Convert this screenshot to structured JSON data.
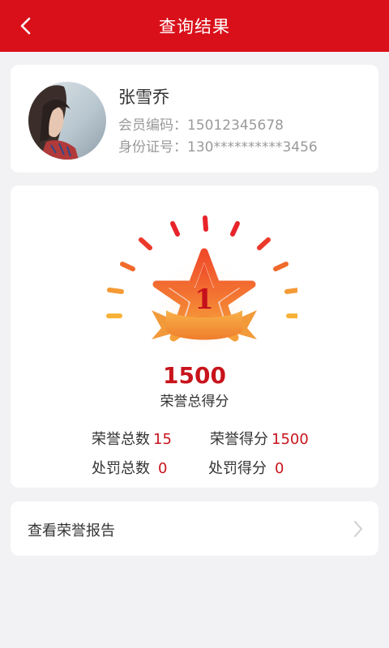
{
  "header": {
    "title": "查询结果"
  },
  "profile": {
    "name": "张雪乔",
    "member_line": "会员编码：15012345678",
    "id_line": "身份证号：130**********3456"
  },
  "honor": {
    "badge_rank": "1",
    "total_score": "1500",
    "total_score_label": "荣誉总得分",
    "stats": {
      "honor_count_label": "荣誉总数",
      "honor_count": "15",
      "honor_score_label": "荣誉得分",
      "honor_score": "1500",
      "penalty_count_label": "处罚总数",
      "penalty_count": "0",
      "penalty_score_label": "处罚得分",
      "penalty_score": "0"
    }
  },
  "report": {
    "label": "查看荣誉报告"
  },
  "colors": {
    "brand": "#d9101a",
    "value": "#c8141c",
    "background": "#f2f2f4"
  },
  "icons": {
    "back": "chevron-left-icon",
    "forward": "chevron-right-icon",
    "badge": "star-rank-badge"
  }
}
